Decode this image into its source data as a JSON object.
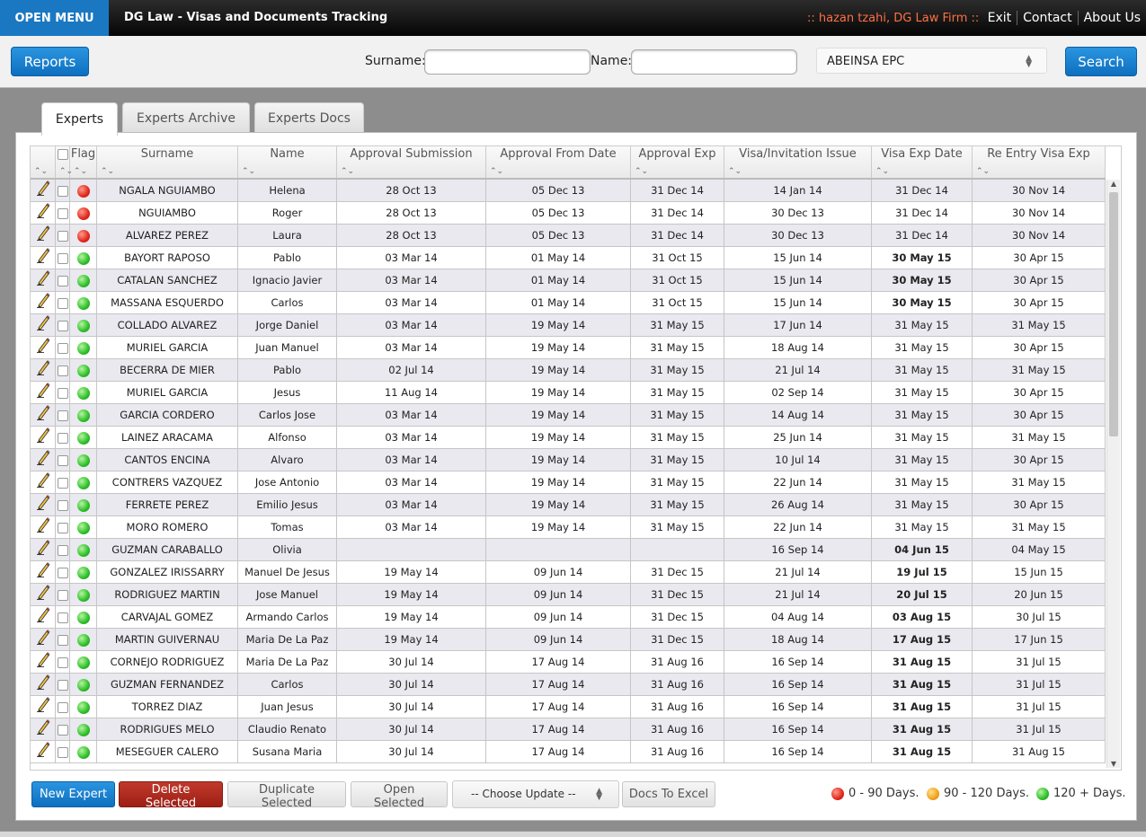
{
  "header": {
    "open_menu": "OPEN MENU",
    "title": "DG Law - Visas and Documents Tracking",
    "user_info": ":: hazan tzahi, DG Law Firm ::",
    "nav": [
      "Exit",
      "Contact",
      "About Us"
    ]
  },
  "search": {
    "reports_label": "Reports",
    "surname_label": "Surname:",
    "name_label": "Name:",
    "surname_value": "",
    "name_value": "",
    "company_selected": "ABEINSA EPC",
    "search_label": "Search"
  },
  "tabs": [
    "Experts",
    "Experts Archive",
    "Experts Docs"
  ],
  "active_tab": 0,
  "table": {
    "columns": [
      "",
      "",
      "Flag",
      "Surname",
      "Name",
      "Approval Submission",
      "Approval From Date",
      "Approval Exp",
      "Visa/Invitation Issue",
      "Visa Exp Date",
      "Re Entry Visa Exp"
    ],
    "rows": [
      {
        "flag": "red",
        "surname": "NGALA NGUIAMBO",
        "name": "Helena",
        "approval_submission": "28 Oct 13",
        "approval_from": "05 Dec 13",
        "approval_exp": "31 Dec 14",
        "visa_issue": "14 Jan 14",
        "visa_exp": "31 Dec 14",
        "visa_exp_bold": false,
        "reentry_exp": "30 Nov 14"
      },
      {
        "flag": "red",
        "surname": "NGUIAMBO",
        "name": "Roger",
        "approval_submission": "28 Oct 13",
        "approval_from": "05 Dec 13",
        "approval_exp": "31 Dec 14",
        "visa_issue": "30 Dec 13",
        "visa_exp": "31 Dec 14",
        "visa_exp_bold": false,
        "reentry_exp": "30 Nov 14"
      },
      {
        "flag": "red",
        "surname": "ALVAREZ PEREZ",
        "name": "Laura",
        "approval_submission": "28 Oct 13",
        "approval_from": "05 Dec 13",
        "approval_exp": "31 Dec 14",
        "visa_issue": "30 Dec 13",
        "visa_exp": "31 Dec 14",
        "visa_exp_bold": false,
        "reentry_exp": "30 Nov 14"
      },
      {
        "flag": "green",
        "surname": "BAYORT RAPOSO",
        "name": "Pablo",
        "approval_submission": "03 Mar 14",
        "approval_from": "01 May 14",
        "approval_exp": "31 Oct 15",
        "visa_issue": "15 Jun 14",
        "visa_exp": "30 May 15",
        "visa_exp_bold": true,
        "reentry_exp": "30 Apr 15"
      },
      {
        "flag": "green",
        "surname": "CATALAN SANCHEZ",
        "name": "Ignacio Javier",
        "approval_submission": "03 Mar 14",
        "approval_from": "01 May 14",
        "approval_exp": "31 Oct 15",
        "visa_issue": "15 Jun 14",
        "visa_exp": "30 May 15",
        "visa_exp_bold": true,
        "reentry_exp": "30 Apr 15"
      },
      {
        "flag": "green",
        "surname": "MASSANA ESQUERDO",
        "name": "Carlos",
        "approval_submission": "03 Mar 14",
        "approval_from": "01 May 14",
        "approval_exp": "31 Oct 15",
        "visa_issue": "15 Jun 14",
        "visa_exp": "30 May 15",
        "visa_exp_bold": true,
        "reentry_exp": "30 Apr 15"
      },
      {
        "flag": "green",
        "surname": "COLLADO ALVAREZ",
        "name": "Jorge Daniel",
        "approval_submission": "03 Mar 14",
        "approval_from": "19 May 14",
        "approval_exp": "31 May 15",
        "visa_issue": "17 Jun 14",
        "visa_exp": "31 May 15",
        "visa_exp_bold": false,
        "reentry_exp": "31 May 15"
      },
      {
        "flag": "green",
        "surname": "MURIEL GARCIA",
        "name": "Juan Manuel",
        "approval_submission": "03 Mar 14",
        "approval_from": "19 May 14",
        "approval_exp": "31 May 15",
        "visa_issue": "18 Aug 14",
        "visa_exp": "31 May 15",
        "visa_exp_bold": false,
        "reentry_exp": "30 Apr 15"
      },
      {
        "flag": "green",
        "surname": "BECERRA DE MIER",
        "name": "Pablo",
        "approval_submission": "02 Jul 14",
        "approval_from": "19 May 14",
        "approval_exp": "31 May 15",
        "visa_issue": "21 Jul 14",
        "visa_exp": "31 May 15",
        "visa_exp_bold": false,
        "reentry_exp": "31 May 15"
      },
      {
        "flag": "green",
        "surname": "MURIEL GARCIA",
        "name": "Jesus",
        "approval_submission": "11 Aug 14",
        "approval_from": "19 May 14",
        "approval_exp": "31 May 15",
        "visa_issue": "02 Sep 14",
        "visa_exp": "31 May 15",
        "visa_exp_bold": false,
        "reentry_exp": "30 Apr 15"
      },
      {
        "flag": "green",
        "surname": "GARCIA CORDERO",
        "name": "Carlos Jose",
        "approval_submission": "03 Mar 14",
        "approval_from": "19 May 14",
        "approval_exp": "31 May 15",
        "visa_issue": "14 Aug 14",
        "visa_exp": "31 May 15",
        "visa_exp_bold": false,
        "reentry_exp": "30 Apr 15"
      },
      {
        "flag": "green",
        "surname": "LAINEZ ARACAMA",
        "name": "Alfonso",
        "approval_submission": "03 Mar 14",
        "approval_from": "19 May 14",
        "approval_exp": "31 May 15",
        "visa_issue": "25 Jun 14",
        "visa_exp": "31 May 15",
        "visa_exp_bold": false,
        "reentry_exp": "31 May 15"
      },
      {
        "flag": "green",
        "surname": "CANTOS ENCINA",
        "name": "Alvaro",
        "approval_submission": "03 Mar 14",
        "approval_from": "19 May 14",
        "approval_exp": "31 May 15",
        "visa_issue": "10 Jul 14",
        "visa_exp": "31 May 15",
        "visa_exp_bold": false,
        "reentry_exp": "30 Apr 15"
      },
      {
        "flag": "green",
        "surname": "CONTRERS VAZQUEZ",
        "name": "Jose Antonio",
        "approval_submission": "03 Mar 14",
        "approval_from": "19 May 14",
        "approval_exp": "31 May 15",
        "visa_issue": "22 Jun 14",
        "visa_exp": "31 May 15",
        "visa_exp_bold": false,
        "reentry_exp": "31 May 15"
      },
      {
        "flag": "green",
        "surname": "FERRETE PEREZ",
        "name": "Emilio Jesus",
        "approval_submission": "03 Mar 14",
        "approval_from": "19 May 14",
        "approval_exp": "31 May 15",
        "visa_issue": "26 Aug 14",
        "visa_exp": "31 May 15",
        "visa_exp_bold": false,
        "reentry_exp": "30 Apr 15"
      },
      {
        "flag": "green",
        "surname": "MORO ROMERO",
        "name": "Tomas",
        "approval_submission": "03 Mar 14",
        "approval_from": "19 May 14",
        "approval_exp": "31 May 15",
        "visa_issue": "22 Jun 14",
        "visa_exp": "31 May 15",
        "visa_exp_bold": false,
        "reentry_exp": "31 May 15"
      },
      {
        "flag": "green",
        "surname": "GUZMAN CARABALLO",
        "name": "Olivia",
        "approval_submission": "",
        "approval_from": "",
        "approval_exp": "",
        "visa_issue": "16 Sep 14",
        "visa_exp": "04 Jun 15",
        "visa_exp_bold": true,
        "reentry_exp": "04 May 15"
      },
      {
        "flag": "green",
        "surname": "GONZALEZ IRISSARRY",
        "name": "Manuel De Jesus",
        "approval_submission": "19 May 14",
        "approval_from": "09 Jun 14",
        "approval_exp": "31 Dec 15",
        "visa_issue": "21 Jul 14",
        "visa_exp": "19 Jul 15",
        "visa_exp_bold": true,
        "reentry_exp": "15 Jun 15"
      },
      {
        "flag": "green",
        "surname": "RODRIGUEZ MARTIN",
        "name": "Jose Manuel",
        "approval_submission": "19 May 14",
        "approval_from": "09 Jun 14",
        "approval_exp": "31 Dec 15",
        "visa_issue": "21 Jul 14",
        "visa_exp": "20 Jul 15",
        "visa_exp_bold": true,
        "reentry_exp": "20 Jun 15"
      },
      {
        "flag": "green",
        "surname": "CARVAJAL GOMEZ",
        "name": "Armando Carlos",
        "approval_submission": "19 May 14",
        "approval_from": "09 Jun 14",
        "approval_exp": "31 Dec 15",
        "visa_issue": "04 Aug 14",
        "visa_exp": "03 Aug 15",
        "visa_exp_bold": true,
        "reentry_exp": "30 Jul 15"
      },
      {
        "flag": "green",
        "surname": "MARTIN GUIVERNAU",
        "name": "Maria De La Paz",
        "approval_submission": "19 May 14",
        "approval_from": "09 Jun 14",
        "approval_exp": "31 Dec 15",
        "visa_issue": "18 Aug 14",
        "visa_exp": "17 Aug 15",
        "visa_exp_bold": true,
        "reentry_exp": "17 Jun 15"
      },
      {
        "flag": "green",
        "surname": "CORNEJO RODRIGUEZ",
        "name": "Maria De La Paz",
        "approval_submission": "30 Jul 14",
        "approval_from": "17 Aug 14",
        "approval_exp": "31 Aug 16",
        "visa_issue": "16 Sep 14",
        "visa_exp": "31 Aug 15",
        "visa_exp_bold": true,
        "reentry_exp": "31 Jul 15"
      },
      {
        "flag": "green",
        "surname": "GUZMAN FERNANDEZ",
        "name": "Carlos",
        "approval_submission": "30 Jul 14",
        "approval_from": "17 Aug 14",
        "approval_exp": "31 Aug 16",
        "visa_issue": "16 Sep 14",
        "visa_exp": "31 Aug 15",
        "visa_exp_bold": true,
        "reentry_exp": "31 Jul 15"
      },
      {
        "flag": "green",
        "surname": "TORREZ DIAZ",
        "name": "Juan Jesus",
        "approval_submission": "30 Jul 14",
        "approval_from": "17 Aug 14",
        "approval_exp": "31 Aug 16",
        "visa_issue": "16 Sep 14",
        "visa_exp": "31 Aug 15",
        "visa_exp_bold": true,
        "reentry_exp": "31 Jul 15"
      },
      {
        "flag": "green",
        "surname": "RODRIGUES MELO",
        "name": "Claudio Renato",
        "approval_submission": "30 Jul 14",
        "approval_from": "17 Aug 14",
        "approval_exp": "31 Aug 16",
        "visa_issue": "16 Sep 14",
        "visa_exp": "31 Aug 15",
        "visa_exp_bold": true,
        "reentry_exp": "31 Jul 15"
      },
      {
        "flag": "green",
        "surname": "MESEGUER CALERO",
        "name": "Susana Maria",
        "approval_submission": "30 Jul 14",
        "approval_from": "17 Aug 14",
        "approval_exp": "31 Aug 16",
        "visa_issue": "16 Sep 14",
        "visa_exp": "31 Aug 15",
        "visa_exp_bold": true,
        "reentry_exp": "31 Aug 15"
      }
    ]
  },
  "actions": {
    "new_expert": "New Expert",
    "delete_selected": "Delete Selected",
    "duplicate_selected": "Duplicate Selected",
    "open_selected": "Open Selected",
    "choose_update": "-- Choose Update --",
    "docs_to_excel": "Docs To Excel"
  },
  "legend": [
    {
      "color": "red",
      "label": "0 - 90 Days."
    },
    {
      "color": "orange",
      "label": "90 - 120 Days."
    },
    {
      "color": "green",
      "label": "120 + Days."
    }
  ],
  "colors": {
    "accent": "#1a78c2",
    "danger": "#9e1f15",
    "user_info": "#ff7043",
    "flag_red": "#e0281c",
    "flag_orange": "#f2a21c",
    "flag_green": "#2ebf2a"
  }
}
